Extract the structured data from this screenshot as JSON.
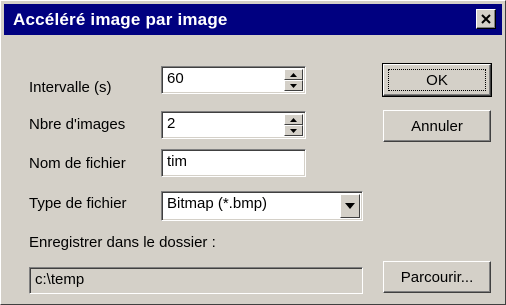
{
  "window": {
    "title": "Accéléré image par image",
    "close_glyph": "✕"
  },
  "fields": {
    "interval": {
      "label": "Intervalle (s)",
      "value": "60"
    },
    "count": {
      "label": "Nbre d'images",
      "value": "2"
    },
    "filename": {
      "label": "Nom de fichier",
      "value": "tim"
    },
    "filetype": {
      "label": "Type de fichier",
      "value": "Bitmap (*.bmp)"
    },
    "folder": {
      "label": "Enregistrer dans le dossier :",
      "value": "c:\\temp"
    }
  },
  "buttons": {
    "ok": "OK",
    "cancel": "Annuler",
    "browse": "Parcourir..."
  },
  "colors": {
    "titlebar": "#000080",
    "face": "#d4d0c8"
  }
}
